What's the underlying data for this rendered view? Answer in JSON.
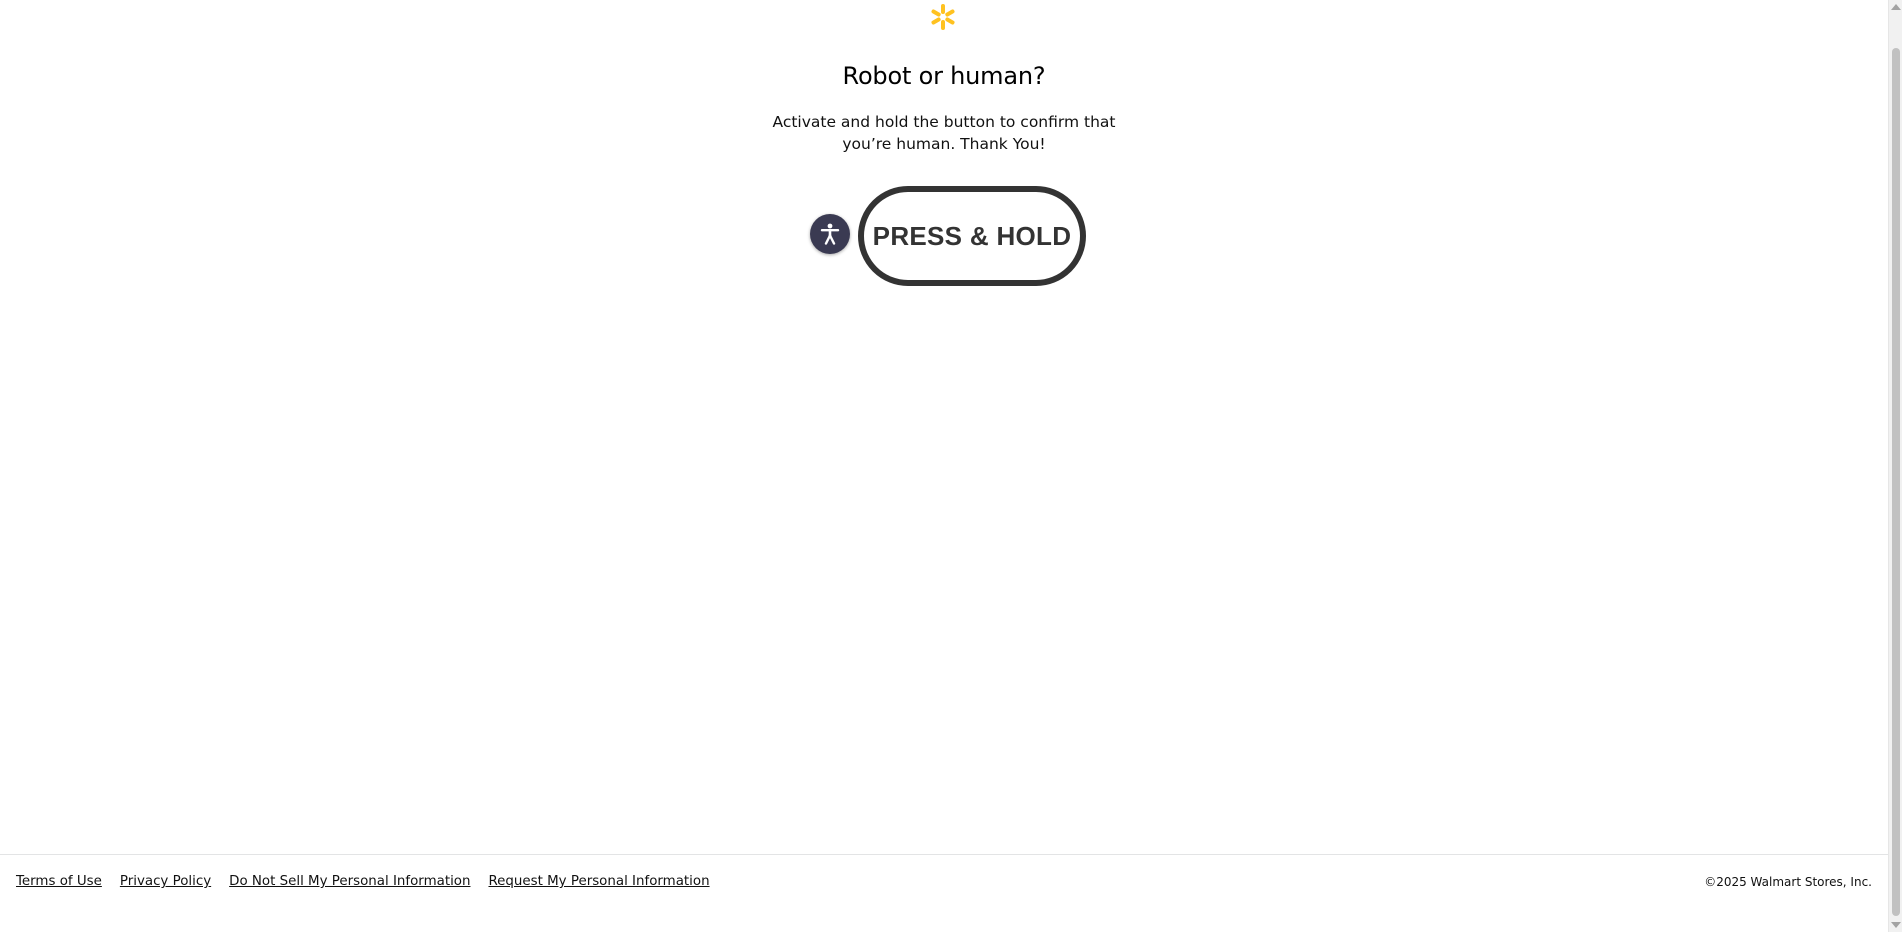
{
  "header": {
    "logo_icon": "walmart-spark-icon",
    "brand_color": "#ffc220"
  },
  "main": {
    "title": "Robot or human?",
    "subtitle_line1": "Activate and hold the button to confirm that",
    "subtitle_line2": "you’re human. Thank You!",
    "accessibility_icon": "accessibility-person-icon",
    "press_hold_label": "PRESS & HOLD"
  },
  "footer": {
    "links": [
      {
        "label": "Terms of Use"
      },
      {
        "label": "Privacy Policy"
      },
      {
        "label": "Do Not Sell My Personal Information"
      },
      {
        "label": "Request My Personal Information"
      }
    ],
    "copyright": "©2025 Walmart Stores, Inc."
  },
  "colors": {
    "button_border": "#333333",
    "accessibility_bg": "#3a3a52"
  }
}
